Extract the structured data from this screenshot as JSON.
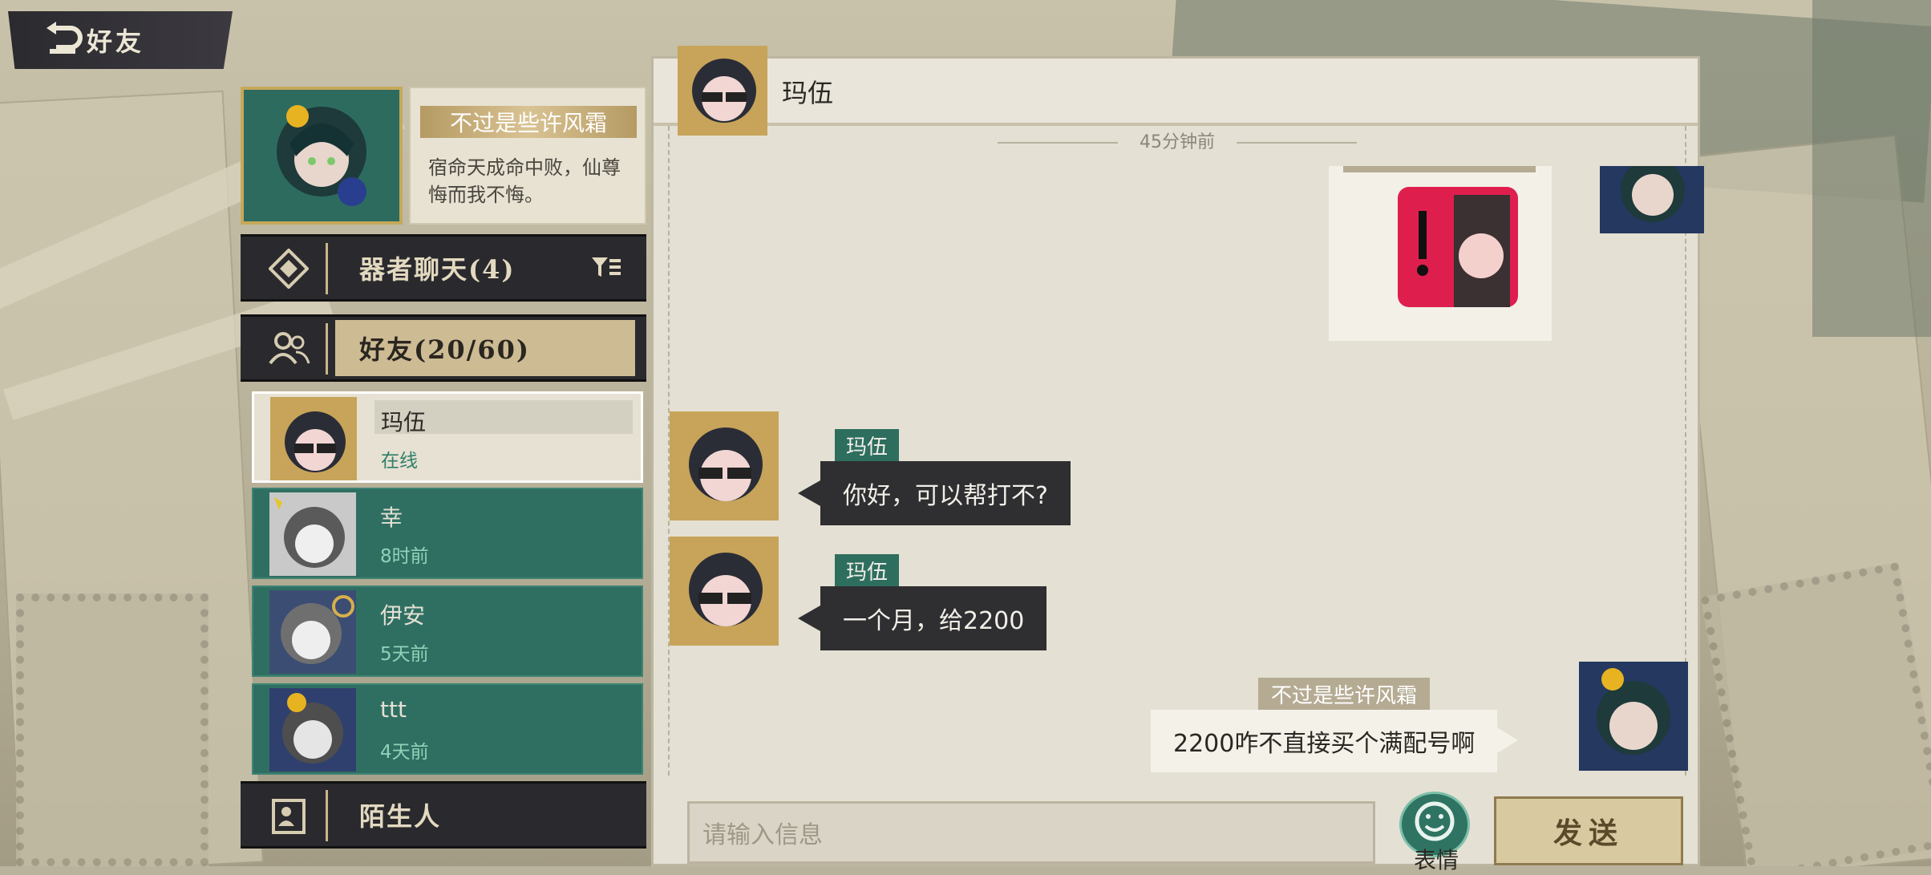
{
  "header": {
    "title": "好友"
  },
  "profile": {
    "name": "不过是些许风霜",
    "signature": "宿命天成命中败，仙尊悔而我不悔。"
  },
  "categories": {
    "chat": {
      "label": "器者聊天(4)"
    },
    "friends": {
      "label": "好友(20/60)"
    },
    "strangers": {
      "label": "陌生人"
    }
  },
  "friends": [
    {
      "name": "玛伍",
      "status": "在线",
      "selected": true
    },
    {
      "name": "幸",
      "status": "8时前"
    },
    {
      "name": "伊安",
      "status": "5天前"
    },
    {
      "name": "ttt",
      "status": "4天前"
    }
  ],
  "chat": {
    "partner": "玛伍",
    "timestamp": "45分钟前",
    "messages": [
      {
        "sender": "玛伍",
        "text": "你好，可以帮打不?"
      },
      {
        "sender": "玛伍",
        "text": "一个月，给2200"
      },
      {
        "sender": "不过是些许风霜",
        "text": "2200咋不直接买个满配号啊"
      }
    ],
    "input_placeholder": "请输入信息",
    "emoji_label": "表情",
    "send_label": "发送"
  },
  "colors": {
    "teal": "#2e6e5f",
    "dark": "#2f2e31",
    "gold": "#c6a85a"
  }
}
